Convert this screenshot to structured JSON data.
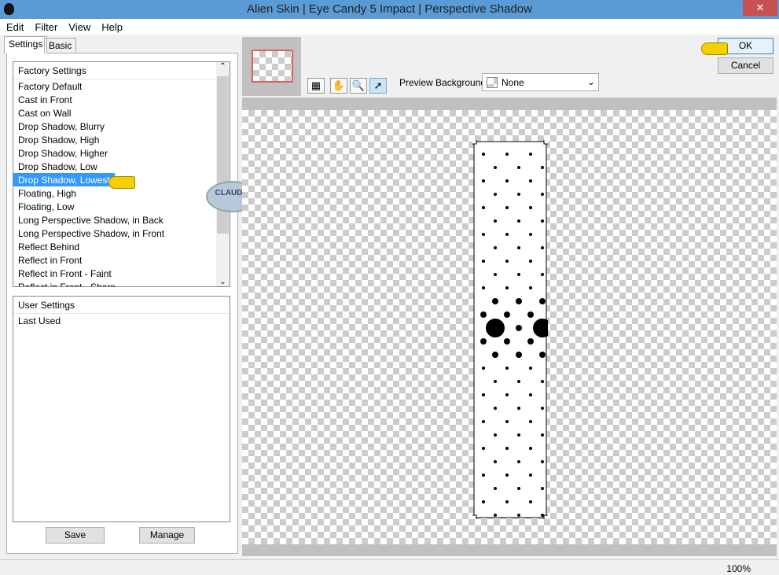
{
  "window": {
    "title": "Alien Skin | Eye Candy 5 Impact | Perspective Shadow"
  },
  "menu": [
    "Edit",
    "Filter",
    "View",
    "Help"
  ],
  "tabs": [
    "Settings",
    "Basic"
  ],
  "factory": {
    "header": "Factory Settings",
    "items": [
      "Factory Default",
      "Cast in Front",
      "Cast on Wall",
      "Drop Shadow, Blurry",
      "Drop Shadow, High",
      "Drop Shadow, Higher",
      "Drop Shadow, Low",
      "Drop Shadow, Lowest",
      "Floating, High",
      "Floating, Low",
      "Long Perspective Shadow, in Back",
      "Long Perspective Shadow, in Front",
      "Reflect Behind",
      "Reflect in Front",
      "Reflect in Front - Faint",
      "Reflect in Front - Sharp"
    ],
    "selected": "Drop Shadow, Lowest"
  },
  "user": {
    "header": "User Settings",
    "items": [
      "Last Used"
    ]
  },
  "buttons": {
    "save": "Save",
    "manage": "Manage",
    "ok": "OK",
    "cancel": "Cancel"
  },
  "preview": {
    "bg_label": "Preview Background:",
    "bg_value": "None"
  },
  "watermark": "CLAUDIA",
  "status": {
    "zoom": "100%"
  }
}
